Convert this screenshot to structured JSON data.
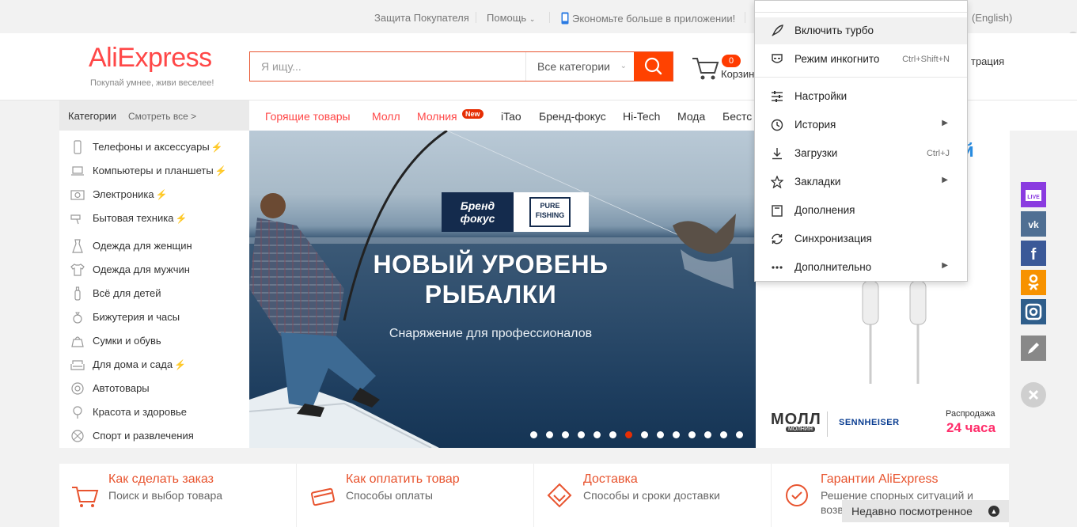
{
  "topbar": {
    "protection": "Защита Покупателя",
    "help": "Помощь",
    "app": "Экономьте больше в приложении!",
    "lang": "(English)"
  },
  "header": {
    "logo": "AliExpress",
    "tagline": "Покупай умнее, живи веселее!",
    "search_placeholder": "Я ищу...",
    "search_category": "Все категории",
    "cart_count": "0",
    "cart_label": "Корзин",
    "register_label": "трация"
  },
  "nav": {
    "categories": "Категории",
    "see_all": "Смотреть все >",
    "new_badge": "New",
    "items": [
      "Горящие товары",
      "Молл",
      "Молния",
      "iTao",
      "Бренд-фокус",
      "Hi-Tech",
      "Мода",
      "Бестс"
    ]
  },
  "sidebar": {
    "items": [
      {
        "label": "Телефоны и аксессуары",
        "icon": "phone-icon",
        "flash": true
      },
      {
        "label": "Компьютеры и планшеты",
        "icon": "laptop-icon",
        "flash": true
      },
      {
        "label": "Электроника",
        "icon": "camera-icon",
        "flash": true
      },
      {
        "label": "Бытовая техника",
        "icon": "hairdryer-icon",
        "flash": true
      },
      {
        "label": "Одежда для женщин",
        "icon": "dress-icon",
        "flash": false
      },
      {
        "label": "Одежда для мужчин",
        "icon": "shirt-icon",
        "flash": false
      },
      {
        "label": "Всё для детей",
        "icon": "bottle-icon",
        "flash": false
      },
      {
        "label": "Бижутерия и часы",
        "icon": "ring-icon",
        "flash": false
      },
      {
        "label": "Сумки и обувь",
        "icon": "bag-icon",
        "flash": false
      },
      {
        "label": "Для дома и сада",
        "icon": "sofa-icon",
        "flash": true
      },
      {
        "label": "Автотовары",
        "icon": "wheel-icon",
        "flash": false
      },
      {
        "label": "Красота и здоровье",
        "icon": "bulb-icon",
        "flash": false
      },
      {
        "label": "Спорт и развлечения",
        "icon": "ball-icon",
        "flash": false
      }
    ]
  },
  "banner": {
    "brand_left": "Бренд фокус",
    "brand_right": "PURE FISHING",
    "title_line1": "НОВЫЙ УРОВЕНЬ",
    "title_line2": "РЫБАЛКИ",
    "subtitle": "Снаряжение для профессионалов",
    "slides": 14,
    "active_slide": 6
  },
  "right_ad": {
    "corner": "й",
    "mall": "МОЛЛ",
    "mall_sub": "МОЛНИЯ",
    "brand": "SENNHEISER",
    "sale": "Распродажа",
    "sale_hours": "24 часа"
  },
  "social": [
    "live-icon",
    "vk-icon",
    "facebook-icon",
    "odnoklassniki-icon",
    "instagram-icon",
    "edit-icon",
    "close-icon"
  ],
  "cards": [
    {
      "title": "Как сделать заказ",
      "sub": "Поиск и выбор товара",
      "icon": "cart-icon"
    },
    {
      "title": "Как оплатить товар",
      "sub": "Способы оплаты",
      "icon": "card-icon"
    },
    {
      "title": "Доставка",
      "sub": "Способы и сроки доставки",
      "icon": "delivery-icon"
    },
    {
      "title": "Гарантии AliExpress",
      "sub": "Решение спорных ситуаций и",
      "sub2": "возв",
      "icon": "guarantee-icon"
    }
  ],
  "recent": "Недавно посмотренное",
  "menu": {
    "items": [
      {
        "label": "Включить турбо",
        "icon": "rocket-icon"
      },
      {
        "label": "Режим инкогнито",
        "icon": "incognito-icon",
        "shortcut": "Ctrl+Shift+N"
      },
      {
        "label": "Настройки",
        "icon": "settings-icon"
      },
      {
        "label": "История",
        "icon": "clock-icon",
        "arrow": "▶"
      },
      {
        "label": "Загрузки",
        "icon": "download-icon",
        "shortcut": "Ctrl+J"
      },
      {
        "label": "Закладки",
        "icon": "star-icon",
        "arrow": "▶"
      },
      {
        "label": "Дополнения",
        "icon": "extensions-icon"
      },
      {
        "label": "Синхронизация",
        "icon": "sync-icon"
      },
      {
        "label": "Дополнительно",
        "icon": "more-icon",
        "arrow": "▶"
      }
    ]
  },
  "colors": {
    "accent": "#ff4747",
    "search_button": "#ff4201",
    "link_orange": "#e8542f"
  }
}
